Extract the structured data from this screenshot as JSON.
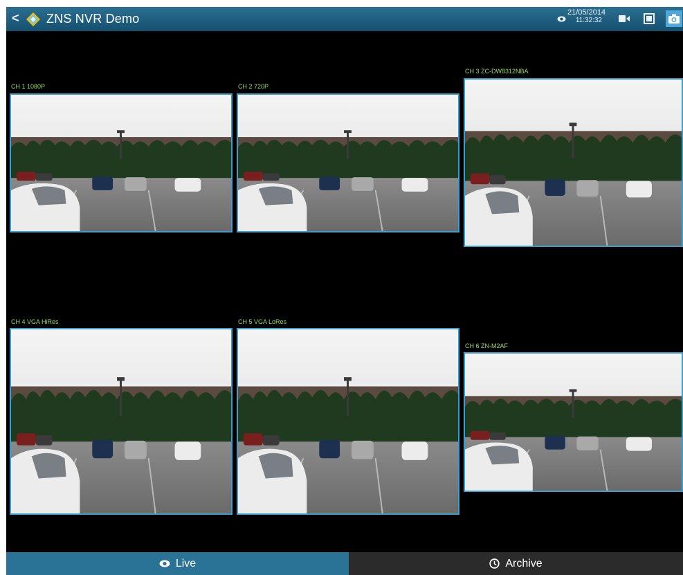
{
  "header": {
    "back_glyph": "<",
    "title": "ZNS NVR Demo",
    "date": "21/05/2014",
    "time": "11:32:32",
    "icons": [
      "back-icon",
      "app-logo-icon",
      "eye-icon",
      "video-camera-icon",
      "stop-icon",
      "camera-icon"
    ]
  },
  "channels": [
    {
      "label": "CH 1 1080P"
    },
    {
      "label": "CH 2 720P"
    },
    {
      "label": "CH 3 ZC-DW8312NBA"
    },
    {
      "label": "CH 4 VGA HiRes"
    },
    {
      "label": "CH 5 VGA LoRes"
    },
    {
      "label": "CH 6 ZN-M2AF"
    }
  ],
  "tabs": {
    "live": "Live",
    "archive": "Archive",
    "active": "live"
  },
  "colors": {
    "accent": "#2a7296",
    "tile_border": "#3a9fd0",
    "label": "#9bd86a"
  }
}
